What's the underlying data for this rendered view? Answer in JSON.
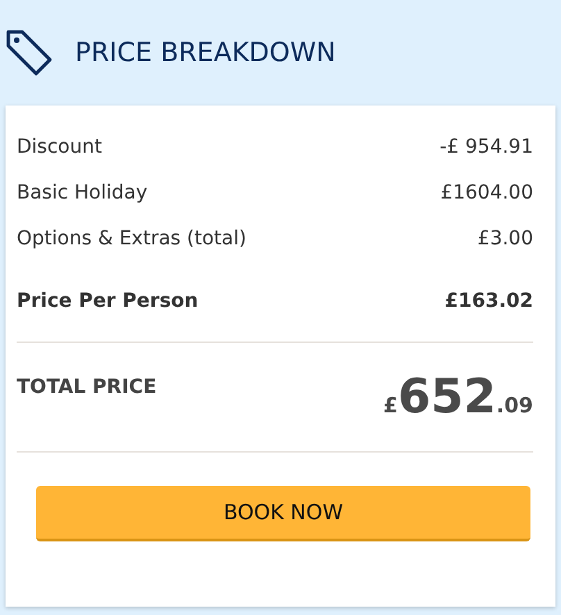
{
  "header": {
    "title": "PRICE BREAKDOWN"
  },
  "lines": [
    {
      "label": "Discount",
      "value": "-£ 954.91",
      "bold": false
    },
    {
      "label": "Basic Holiday",
      "value": "£1604.00",
      "bold": false
    },
    {
      "label": "Options & Extras (total)",
      "value": "£3.00",
      "bold": false
    },
    {
      "label": "Price Per Person",
      "value": "£163.02",
      "bold": true
    }
  ],
  "total": {
    "label": "TOTAL PRICE",
    "currency": "£",
    "whole": "652",
    "fraction": ".09"
  },
  "button": {
    "label": "BOOK NOW"
  }
}
